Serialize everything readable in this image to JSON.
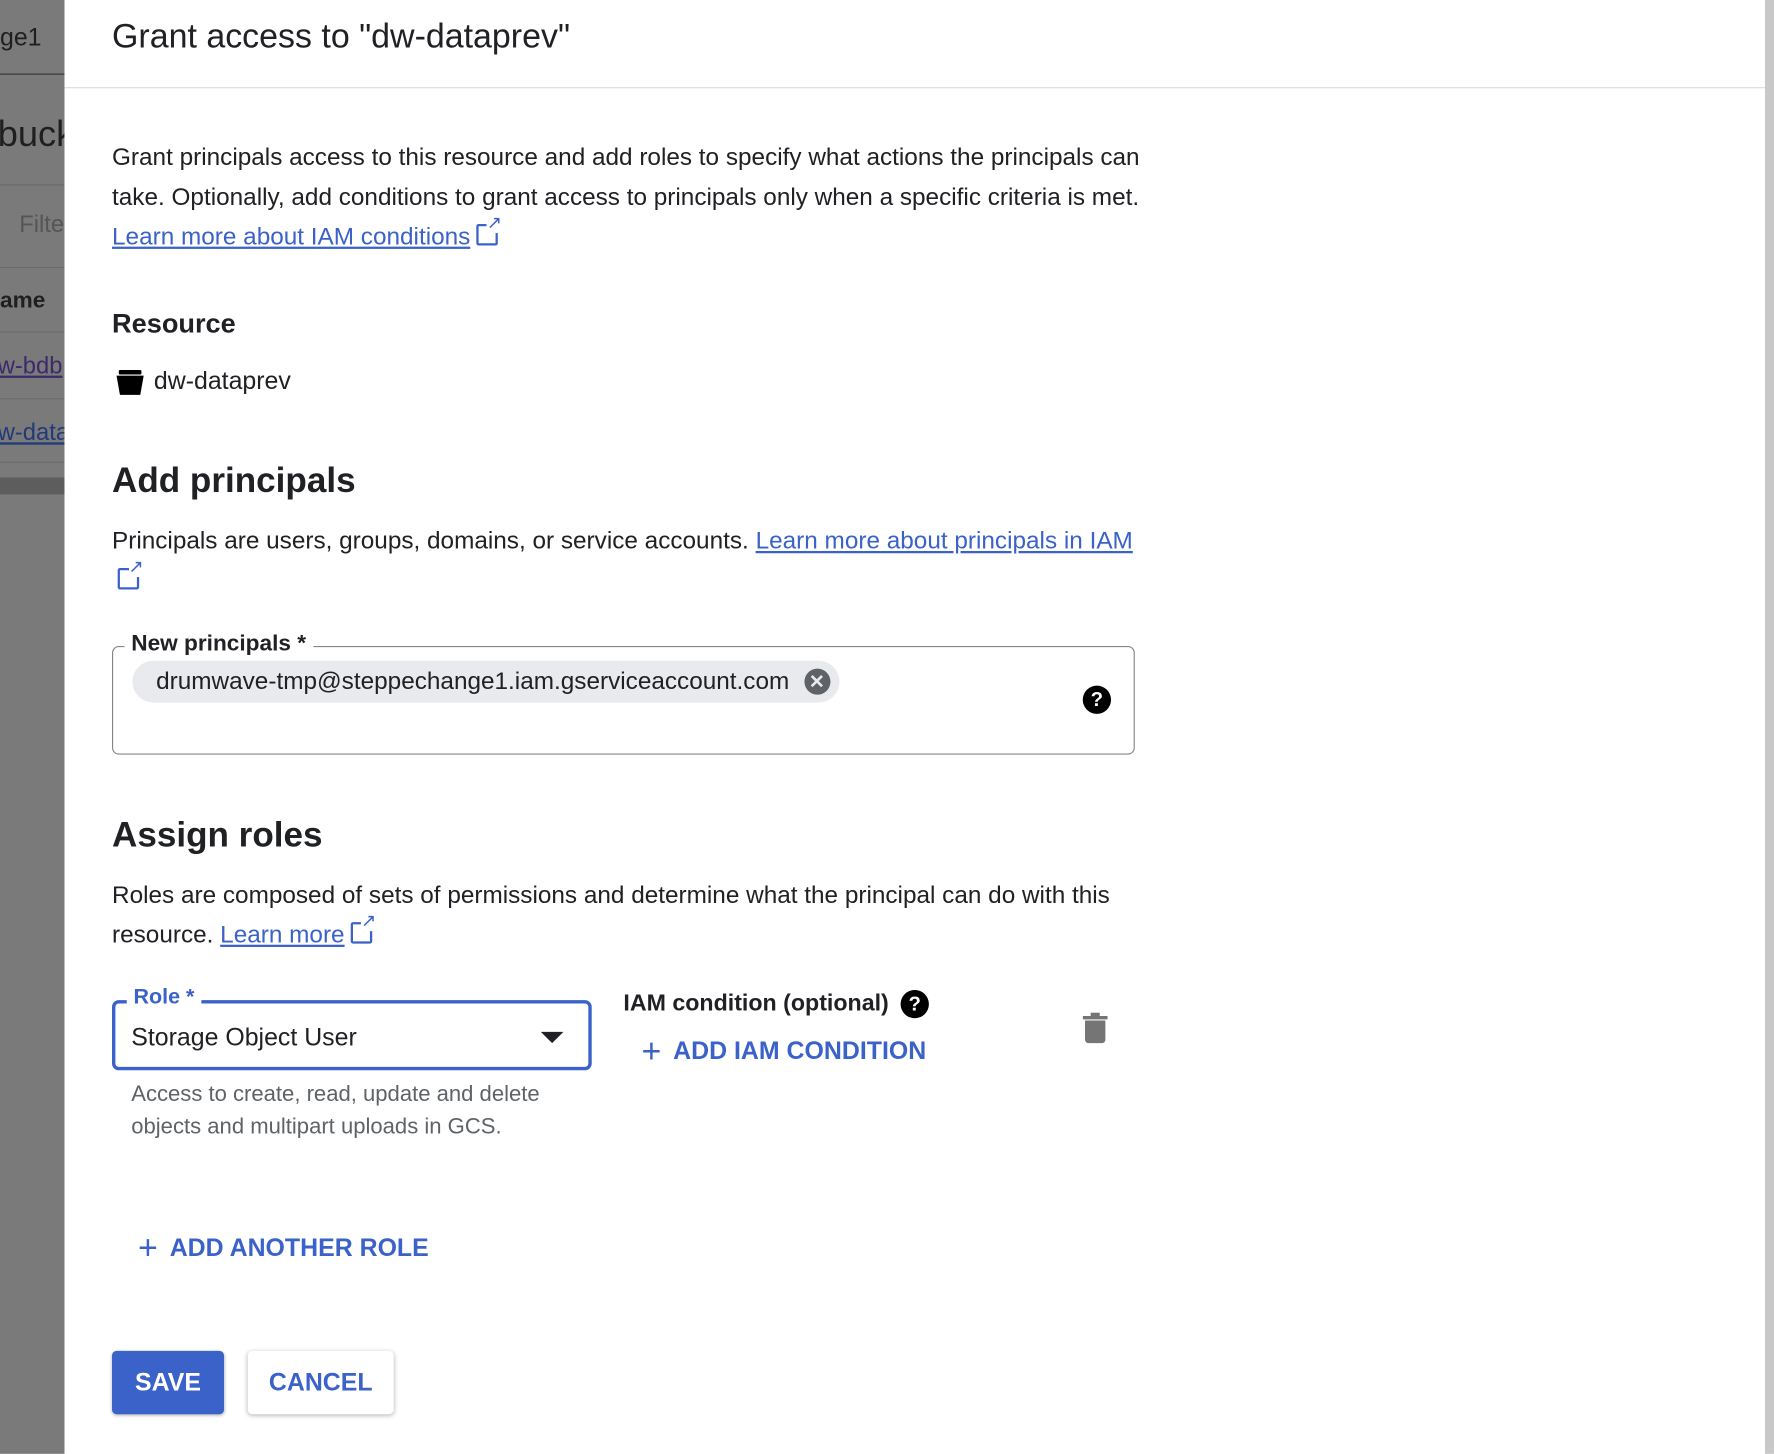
{
  "background": {
    "tab_fragment": "ge1",
    "title_fragment": "buck",
    "filter_fragment": "Filte",
    "column_fragment": "ame",
    "rows": [
      "w-bdb",
      "w-data"
    ]
  },
  "dialog": {
    "title": "Grant access to \"dw-dataprev\"",
    "intro": "Grant principals access to this resource and add roles to specify what actions the principals can take. Optionally, add conditions to grant access to principals only when a specific criteria is met.",
    "intro_link": "Learn more about IAM conditions",
    "resource_heading": "Resource",
    "resource_name": "dw-dataprev",
    "add_principals_heading": "Add principals",
    "principals_desc": "Principals are users, groups, domains, or service accounts.",
    "principals_link": "Learn more about principals in IAM",
    "new_principals_label": "New principals *",
    "principal_chip": "drumwave-tmp@steppechange1.iam.gserviceaccount.com",
    "assign_roles_heading": "Assign roles",
    "roles_desc": "Roles are composed of sets of permissions and determine what the principal can do with this resource.",
    "roles_link": "Learn more",
    "role_label": "Role *",
    "role_value": "Storage Object User",
    "role_hint": "Access to create, read, update and delete objects and multipart uploads in GCS.",
    "iam_condition_label": "IAM condition (optional)",
    "add_iam_condition": "ADD IAM CONDITION",
    "add_another_role": "ADD ANOTHER ROLE",
    "save": "SAVE",
    "cancel": "CANCEL"
  },
  "colors": {
    "accent": "#3b62c9",
    "link": "#3b62c9"
  }
}
